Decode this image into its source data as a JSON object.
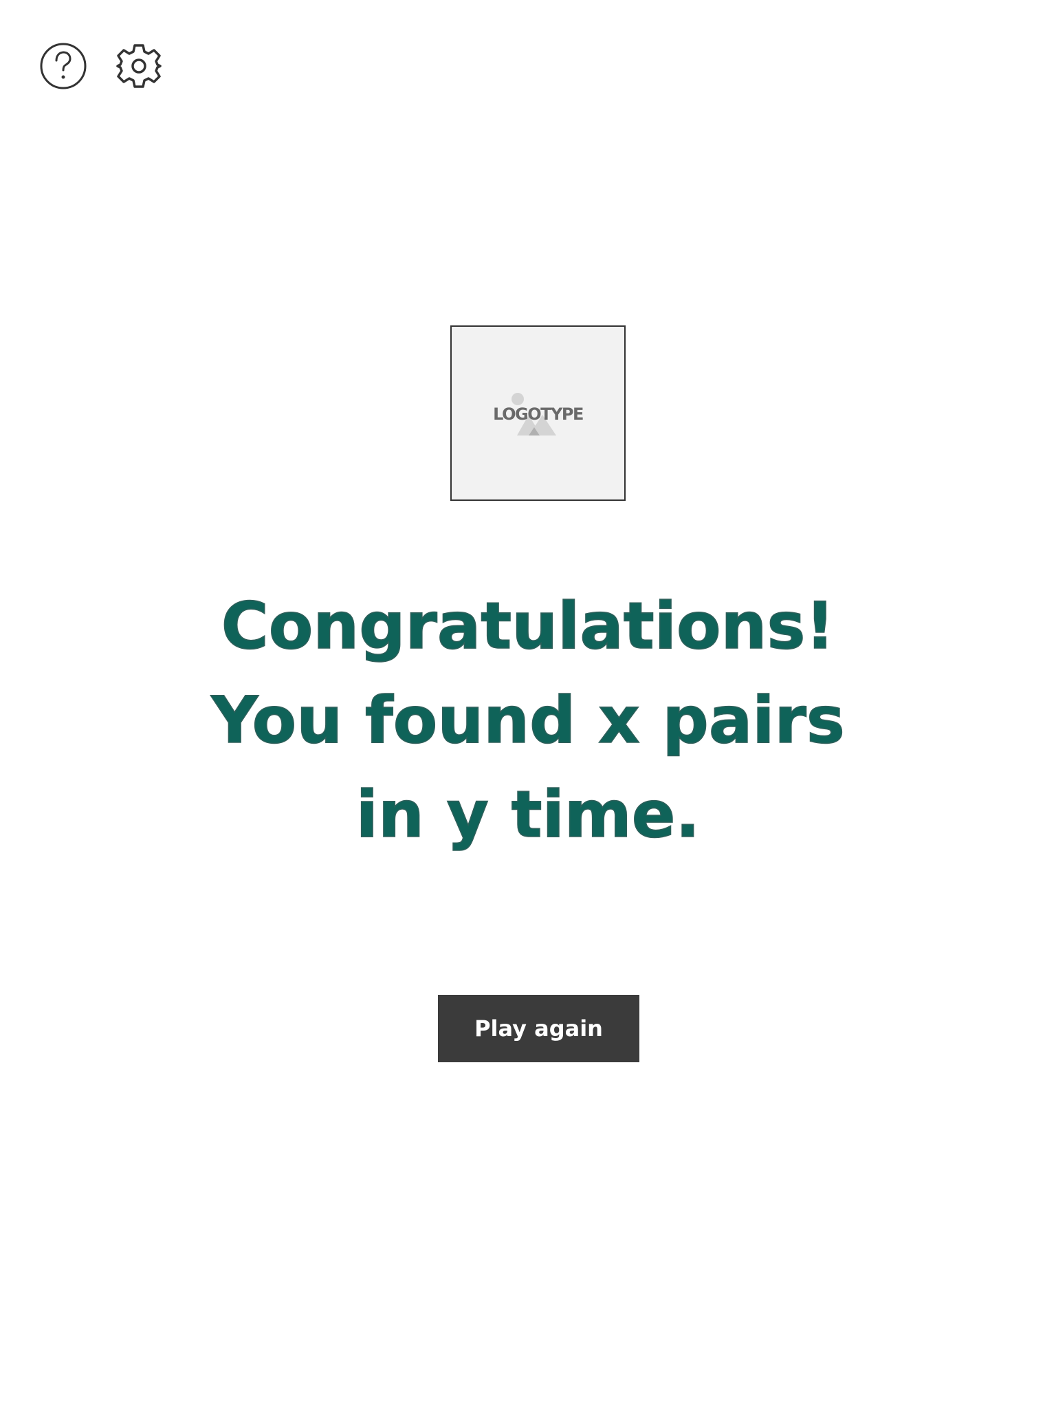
{
  "toolbar": {
    "help_icon": "help-circle-icon",
    "settings_icon": "gear-icon"
  },
  "logo": {
    "text": "LOGOTYPE"
  },
  "result": {
    "line1": "Congratulations!",
    "line2": "You found x pairs",
    "line3": "in y time."
  },
  "actions": {
    "play_again_label": "Play again"
  },
  "colors": {
    "headline": "#0f6359",
    "button_bg": "#3b3b3b",
    "button_text": "#ffffff",
    "icon_stroke": "#333333",
    "logo_bg": "#f2f2f2"
  }
}
